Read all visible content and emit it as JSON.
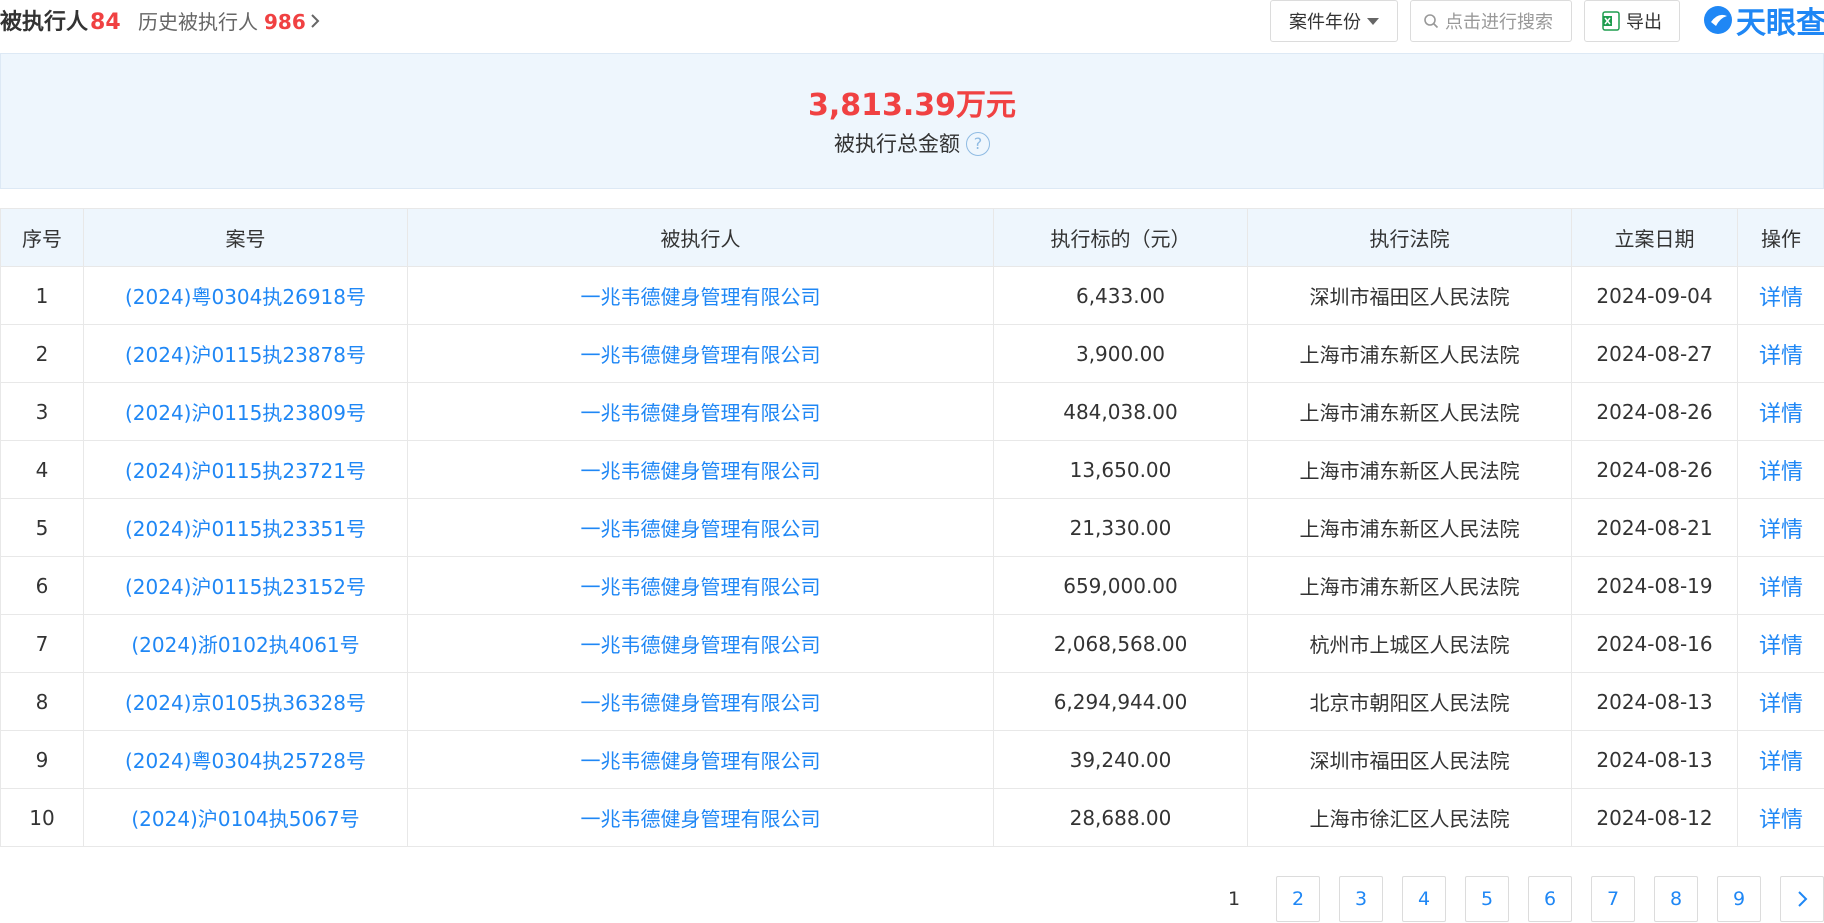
{
  "header": {
    "tab_active_label": "被执行人",
    "tab_active_count": "84",
    "tab_history_label": "历史被执行人",
    "tab_history_count": "986",
    "year_filter_label": "案件年份",
    "search_placeholder": "点击进行搜索",
    "export_label": "导出",
    "logo_text": "天眼查"
  },
  "summary": {
    "amount": "3,813.39万元",
    "label": "被执行总金额"
  },
  "table": {
    "headers": [
      "序号",
      "案号",
      "被执行人",
      "执行标的（元）",
      "执行法院",
      "立案日期",
      "操作"
    ],
    "rows": [
      {
        "no": "1",
        "case": "(2024)粤0304执26918号",
        "party": "一兆韦德健身管理有限公司",
        "amount": "6,433.00",
        "court": "深圳市福田区人民法院",
        "date": "2024-09-04",
        "action": "详情"
      },
      {
        "no": "2",
        "case": "(2024)沪0115执23878号",
        "party": "一兆韦德健身管理有限公司",
        "amount": "3,900.00",
        "court": "上海市浦东新区人民法院",
        "date": "2024-08-27",
        "action": "详情"
      },
      {
        "no": "3",
        "case": "(2024)沪0115执23809号",
        "party": "一兆韦德健身管理有限公司",
        "amount": "484,038.00",
        "court": "上海市浦东新区人民法院",
        "date": "2024-08-26",
        "action": "详情"
      },
      {
        "no": "4",
        "case": "(2024)沪0115执23721号",
        "party": "一兆韦德健身管理有限公司",
        "amount": "13,650.00",
        "court": "上海市浦东新区人民法院",
        "date": "2024-08-26",
        "action": "详情"
      },
      {
        "no": "5",
        "case": "(2024)沪0115执23351号",
        "party": "一兆韦德健身管理有限公司",
        "amount": "21,330.00",
        "court": "上海市浦东新区人民法院",
        "date": "2024-08-21",
        "action": "详情"
      },
      {
        "no": "6",
        "case": "(2024)沪0115执23152号",
        "party": "一兆韦德健身管理有限公司",
        "amount": "659,000.00",
        "court": "上海市浦东新区人民法院",
        "date": "2024-08-19",
        "action": "详情"
      },
      {
        "no": "7",
        "case": "(2024)浙0102执4061号",
        "party": "一兆韦德健身管理有限公司",
        "amount": "2,068,568.00",
        "court": "杭州市上城区人民法院",
        "date": "2024-08-16",
        "action": "详情"
      },
      {
        "no": "8",
        "case": "(2024)京0105执36328号",
        "party": "一兆韦德健身管理有限公司",
        "amount": "6,294,944.00",
        "court": "北京市朝阳区人民法院",
        "date": "2024-08-13",
        "action": "详情"
      },
      {
        "no": "9",
        "case": "(2024)粤0304执25728号",
        "party": "一兆韦德健身管理有限公司",
        "amount": "39,240.00",
        "court": "深圳市福田区人民法院",
        "date": "2024-08-13",
        "action": "详情"
      },
      {
        "no": "10",
        "case": "(2024)沪0104执5067号",
        "party": "一兆韦德健身管理有限公司",
        "amount": "28,688.00",
        "court": "上海市徐汇区人民法院",
        "date": "2024-08-12",
        "action": "详情"
      }
    ]
  },
  "pagination": {
    "current": "1",
    "pages": [
      "2",
      "3",
      "4",
      "5",
      "6",
      "7",
      "8",
      "9"
    ]
  },
  "colors": {
    "accent_blue": "#1f87f5",
    "highlight_red": "#f04142",
    "summary_bg": "#eef6fd"
  },
  "icons": {
    "year_filter": "caret-down-icon",
    "search": "search-icon",
    "export": "excel-icon",
    "help": "question-circle-icon",
    "next": "chevron-right-icon"
  }
}
